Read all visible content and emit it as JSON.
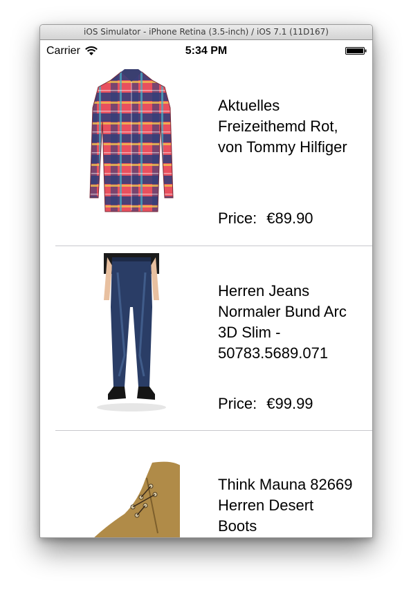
{
  "window": {
    "title": "iOS Simulator - iPhone Retina (3.5-inch) / iOS 7.1 (11D167)"
  },
  "status_bar": {
    "carrier": "Carrier",
    "time": "5:34 PM"
  },
  "products": [
    {
      "title": "Aktuelles Freizeithemd Rot, von Tommy Hilfiger",
      "price_label": "Price:",
      "price": "€89.90",
      "image": "plaid-shirt"
    },
    {
      "title": "Herren Jeans Normaler Bund Arc 3D Slim - 50783.5689.071",
      "price_label": "Price:",
      "price": "€99.99",
      "image": "jeans"
    },
    {
      "title": "Think Mauna 82669 Herren Desert Boots",
      "image": "desert-boot"
    }
  ]
}
